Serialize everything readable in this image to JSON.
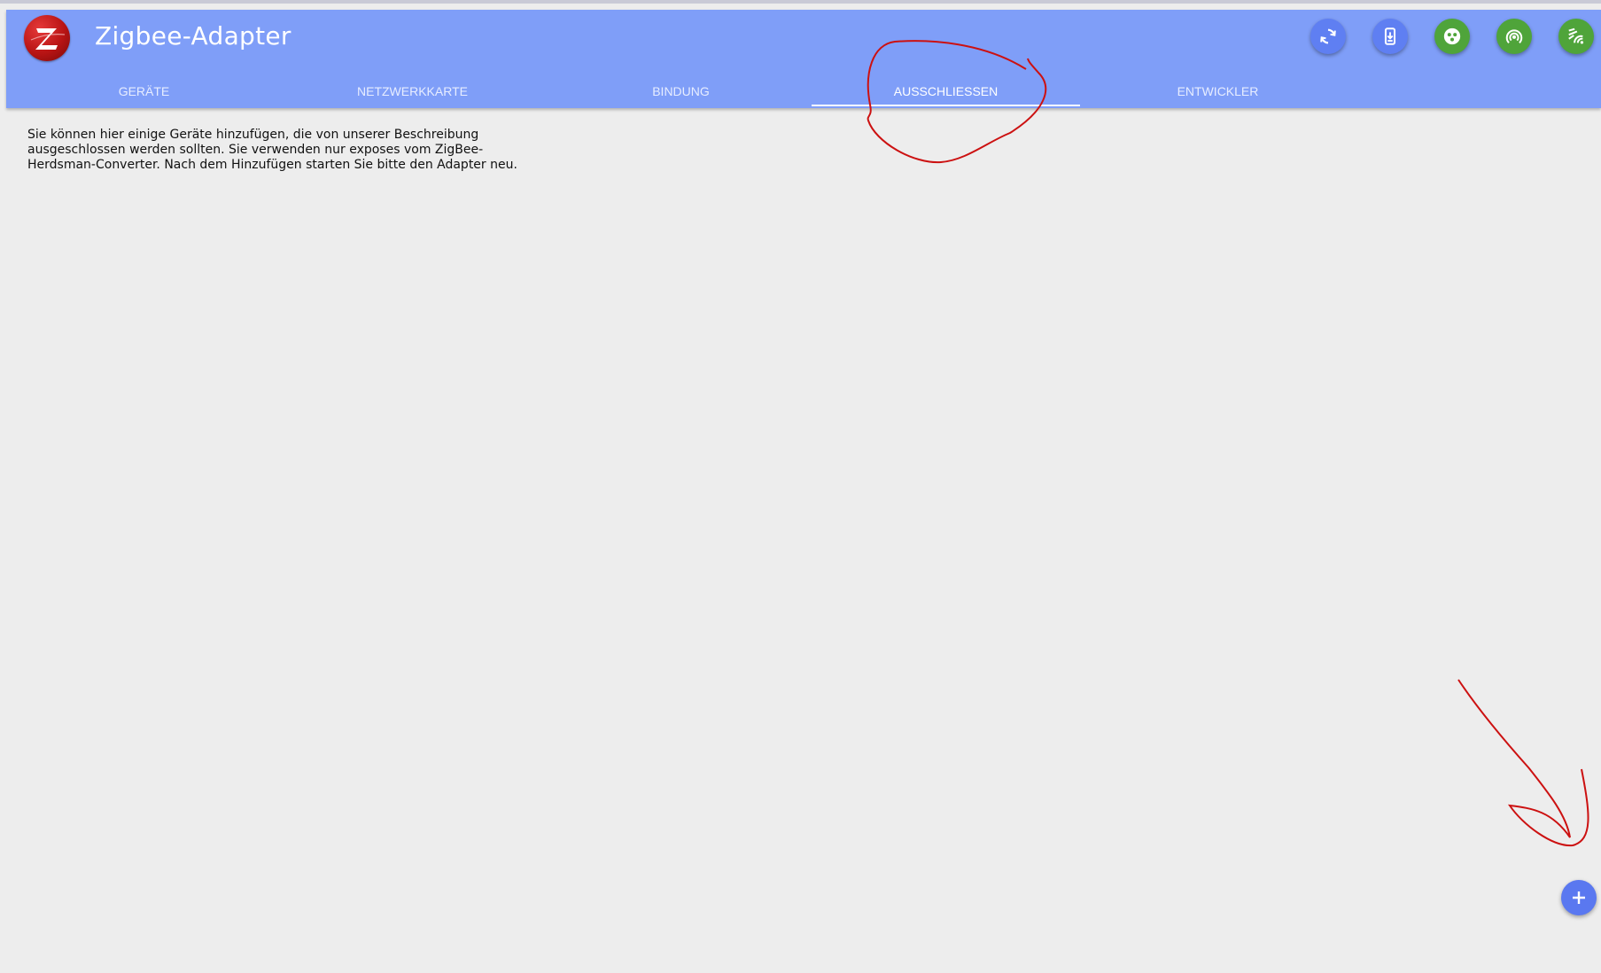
{
  "header": {
    "app_title": "Zigbee-Adapter",
    "brand_color": "#7f9ef8",
    "buttons": [
      {
        "name": "refresh-icon",
        "color": "#5f7ff2"
      },
      {
        "name": "mobile-download-icon",
        "color": "#5f7ff2"
      },
      {
        "name": "join-network-icon",
        "color": "#4fa43a"
      },
      {
        "name": "signal-scan-icon",
        "color": "#4fa43a"
      },
      {
        "name": "wifi-tool-icon",
        "color": "#4fa43a"
      }
    ]
  },
  "tabs": [
    {
      "label": "GERÄTE",
      "active": false
    },
    {
      "label": "NETZWERKKARTE",
      "active": false
    },
    {
      "label": "BINDUNG",
      "active": false
    },
    {
      "label": "AUSSCHLIESSEN",
      "active": true
    },
    {
      "label": "ENTWICKLER",
      "active": false
    }
  ],
  "main": {
    "description": "Sie können hier einige Geräte hinzufügen, die von unserer Beschreibung ausgeschlossen werden sollten. Sie verwenden nur exposes vom ZigBee-Herdsman-Converter. Nach dem Hinzufügen starten Sie bitte den Adapter neu."
  },
  "fab": {
    "icon": "plus-icon",
    "color": "#5a78f0"
  },
  "annotations": {
    "color": "#cc1111"
  }
}
